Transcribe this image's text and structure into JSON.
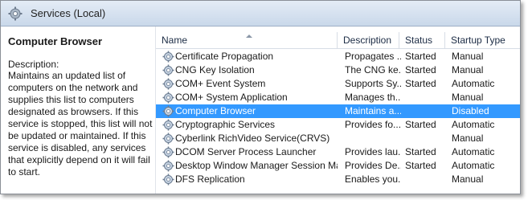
{
  "window": {
    "title": "Services (Local)"
  },
  "details": {
    "service_name": "Computer Browser",
    "description_label": "Description:",
    "description": "Maintains an updated list of computers on the network and supplies this list to computers designated as browsers. If this service is stopped, this list will not be updated or maintained. If this service is disabled, any services that explicitly depend on it will fail to start."
  },
  "table": {
    "columns": [
      "Name",
      "Description",
      "Status",
      "Startup Type"
    ],
    "sorted_column": "Name",
    "selected_row": 4,
    "rows": [
      {
        "name": "Certificate Propagation",
        "description": "Propagates ...",
        "status": "Started",
        "startup": "Manual"
      },
      {
        "name": "CNG Key Isolation",
        "description": "The CNG ke...",
        "status": "Started",
        "startup": "Manual"
      },
      {
        "name": "COM+ Event System",
        "description": "Supports Sy...",
        "status": "Started",
        "startup": "Automatic"
      },
      {
        "name": "COM+ System Application",
        "description": "Manages th...",
        "status": "",
        "startup": "Manual"
      },
      {
        "name": "Computer Browser",
        "description": "Maintains a...",
        "status": "",
        "startup": "Disabled"
      },
      {
        "name": "Cryptographic Services",
        "description": "Provides fo...",
        "status": "Started",
        "startup": "Automatic"
      },
      {
        "name": "Cyberlink RichVideo Service(CRVS)",
        "description": "",
        "status": "",
        "startup": "Manual"
      },
      {
        "name": "DCOM Server Process Launcher",
        "description": "Provides lau...",
        "status": "Started",
        "startup": "Automatic"
      },
      {
        "name": "Desktop Window Manager Session Mana...",
        "description": "Provides De...",
        "status": "Started",
        "startup": "Automatic"
      },
      {
        "name": "DFS Replication",
        "description": "Enables you...",
        "status": "",
        "startup": "Manual"
      }
    ]
  },
  "icons": {
    "title": "services-gear-icon",
    "row": "service-gear-icon"
  },
  "colors": {
    "selection": "#3399ff",
    "titlebar": "#c9d8ea"
  }
}
